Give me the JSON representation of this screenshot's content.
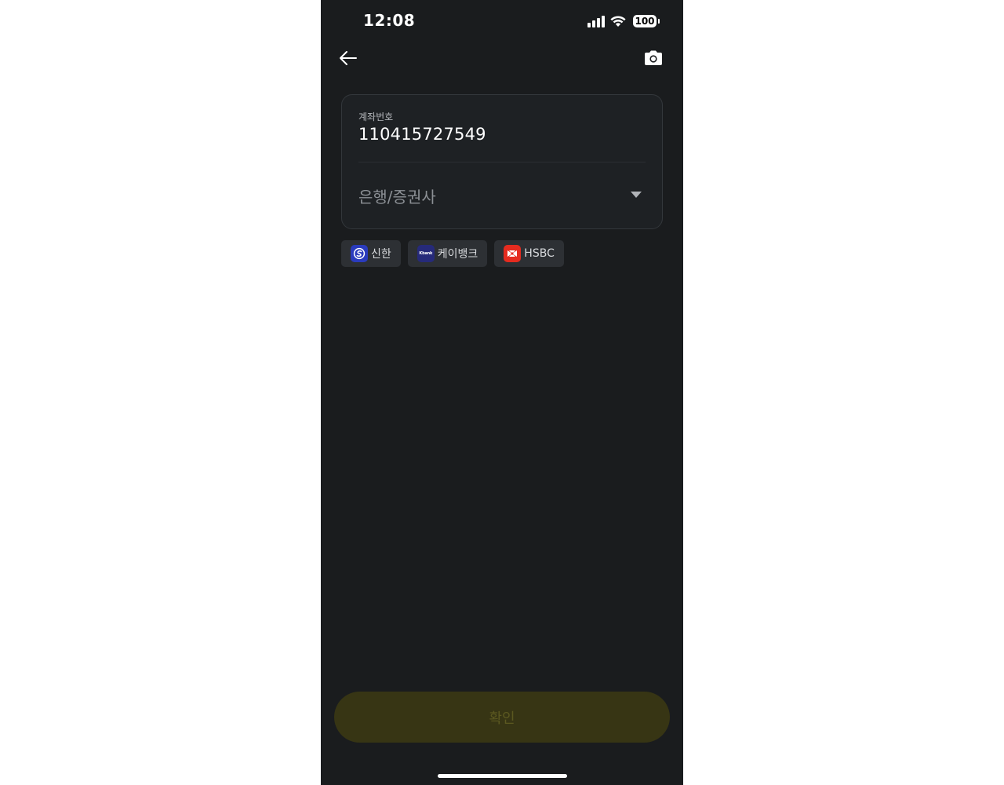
{
  "status_bar": {
    "time": "12:08",
    "battery": "100"
  },
  "nav": {
    "back_icon": "arrow-left-icon",
    "camera_icon": "camera-icon"
  },
  "form": {
    "account_label": "계좌번호",
    "account_value": "110415727549",
    "bank_placeholder": "은행/증권사"
  },
  "quick_banks": [
    {
      "label": "신한",
      "logo_color": "#2a3bbd"
    },
    {
      "label": "케이뱅크",
      "logo_text": "Kbank",
      "logo_color": "#262a7a"
    },
    {
      "label": "HSBC",
      "logo_color": "#e52b1f"
    }
  ],
  "confirm": {
    "label": "확인"
  },
  "colors": {
    "background": "#1a1c1e",
    "card_border": "#33373b",
    "chip_background": "#2d3034",
    "confirm_disabled": "#373514",
    "confirm_label_disabled": "#5b5820"
  }
}
